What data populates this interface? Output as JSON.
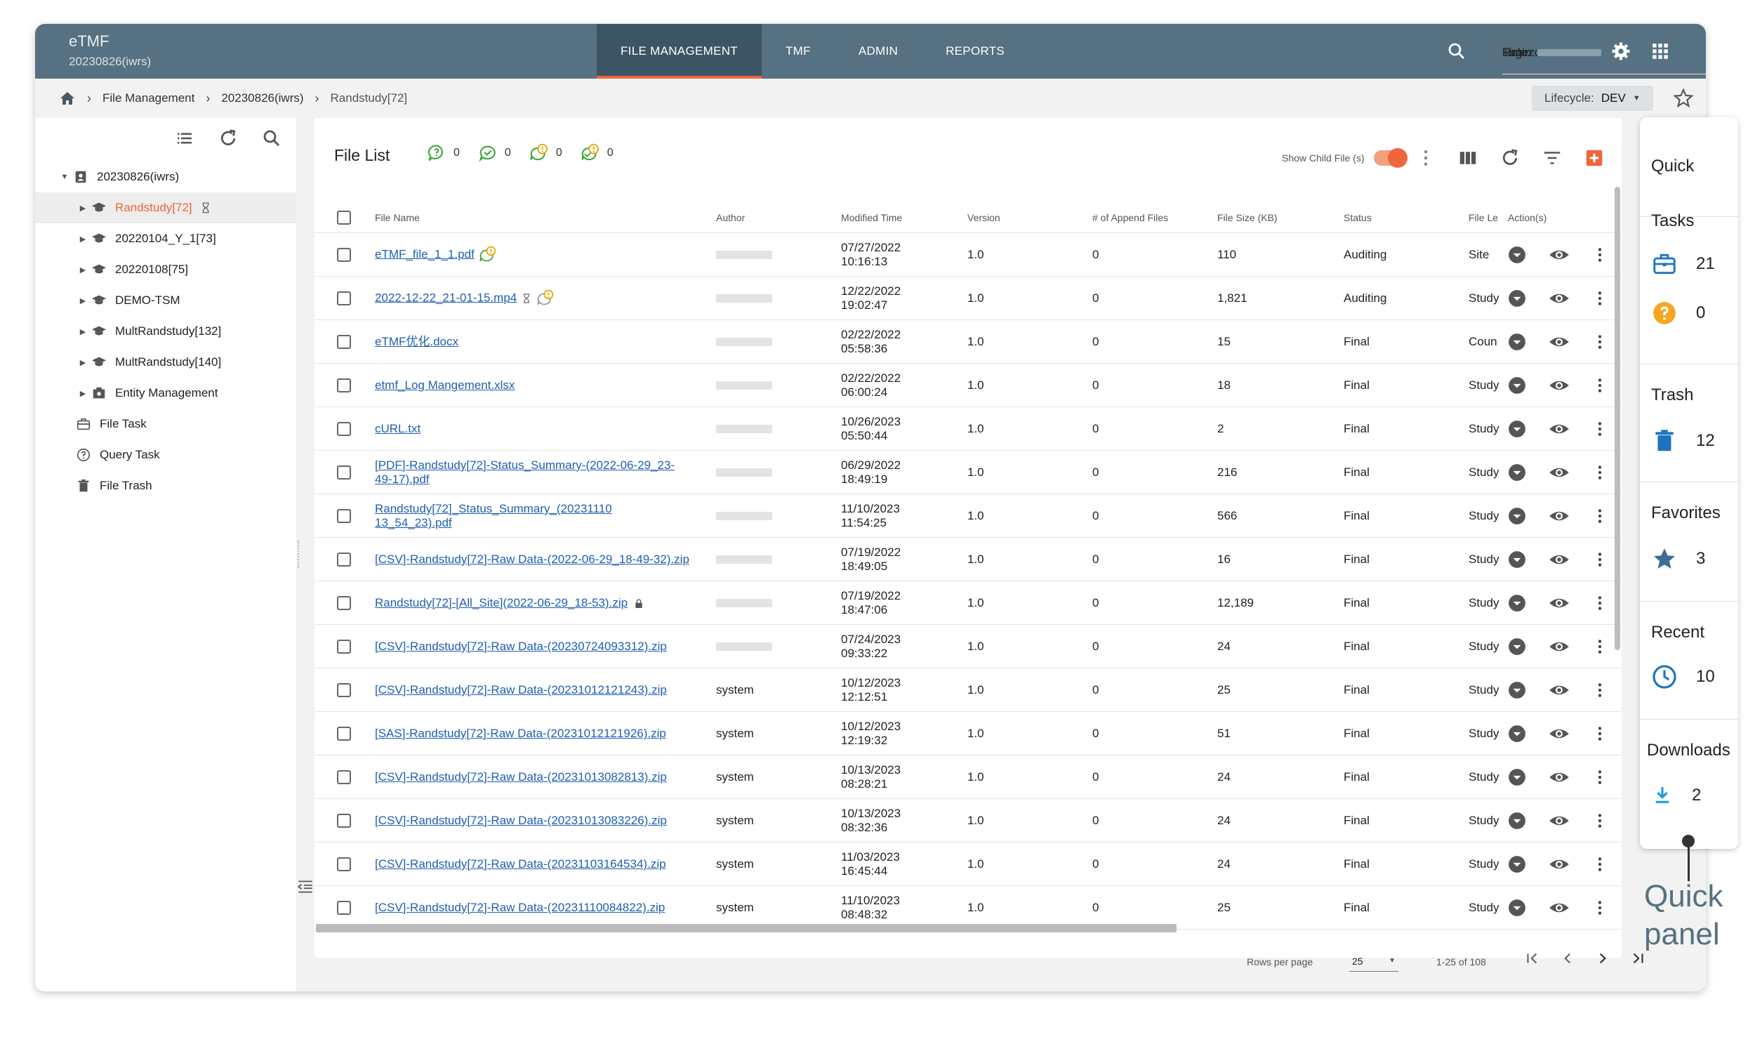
{
  "app": {
    "title": "eTMF",
    "subtitle": "20230826(iwrs)"
  },
  "nav": {
    "items": [
      {
        "label": "FILE MANAGEMENT",
        "active": true
      },
      {
        "label": "TMF"
      },
      {
        "label": "ADMIN"
      },
      {
        "label": "REPORTS"
      }
    ]
  },
  "user": {
    "login_label": "Login:",
    "timezone_label": "Timezone:",
    "role_label": "Role:"
  },
  "breadcrumb": {
    "items": [
      "File Management",
      "20230826(iwrs)",
      "Randstudy[72]"
    ]
  },
  "lifecycle": {
    "label": "Lifecycle:",
    "value": "DEV"
  },
  "tree": {
    "root": "20230826(iwrs)",
    "studies": [
      "Randstudy[72]",
      "20220104_Y_1[73]",
      "20220108[75]",
      "DEMO-TSM",
      "MultRandstudy[132]",
      "MultRandstudy[140]",
      "Entity Management"
    ],
    "links": [
      "File Task",
      "Query Task",
      "File Trash"
    ]
  },
  "file_list": {
    "title": "File List",
    "counters": [
      "0",
      "0",
      "0",
      "0"
    ],
    "show_child_label": "Show Child File (s)",
    "columns": {
      "file_name": "File Name",
      "author": "Author",
      "modified": "Modified Time",
      "version": "Version",
      "append": "# of Append Files",
      "size": "File Size (KB)",
      "status": "Status",
      "level": "File Le",
      "actions": "Action(s)"
    },
    "rows": [
      {
        "name": "eTMF_file_1_1.pdf",
        "author": "",
        "date": "07/27/2022",
        "time": "10:16:13",
        "version": "1.0",
        "append": "0",
        "size": "110",
        "status": "Auditing",
        "level": "Site"
      },
      {
        "name": "2022-12-22_21-01-15.mp4",
        "author": "",
        "date": "12/22/2022",
        "time": "19:02:47",
        "version": "1.0",
        "append": "0",
        "size": "1,821",
        "status": "Auditing",
        "level": "Study"
      },
      {
        "name": "eTMF优化.docx",
        "author": "",
        "date": "02/22/2022",
        "time": "05:58:36",
        "version": "1.0",
        "append": "0",
        "size": "15",
        "status": "Final",
        "level": "Coun"
      },
      {
        "name": "etmf_Log Mangement.xlsx",
        "author": "",
        "date": "02/22/2022",
        "time": "06:00:24",
        "version": "1.0",
        "append": "0",
        "size": "18",
        "status": "Final",
        "level": "Study"
      },
      {
        "name": "cURL.txt",
        "author": "",
        "date": "10/26/2023",
        "time": "05:50:44",
        "version": "1.0",
        "append": "0",
        "size": "2",
        "status": "Final",
        "level": "Study"
      },
      {
        "name": "[PDF]-Randstudy[72]-Status_Summary-(2022-06-29_23-",
        "name2": "49-17).pdf",
        "author": "",
        "date": "06/29/2022",
        "time": "18:49:19",
        "version": "1.0",
        "append": "0",
        "size": "216",
        "status": "Final",
        "level": "Study"
      },
      {
        "name": "Randstudy[72]_Status_Summary_(20231110",
        "name2": "13_54_23).pdf",
        "author": "",
        "date": "11/10/2023",
        "time": "11:54:25",
        "version": "1.0",
        "append": "0",
        "size": "566",
        "status": "Final",
        "level": "Study"
      },
      {
        "name": "[CSV]-Randstudy[72]-Raw Data-(2022-06-29_18-49-32).zip",
        "author": "",
        "date": "07/19/2022",
        "time": "18:49:05",
        "version": "1.0",
        "append": "0",
        "size": "16",
        "status": "Final",
        "level": "Study"
      },
      {
        "name": "Randstudy[72]-[All_Site](2022-06-29_18-53).zip",
        "author": "",
        "date": "07/19/2022",
        "time": "18:47:06",
        "version": "1.0",
        "append": "0",
        "size": "12,189",
        "status": "Final",
        "level": "Study"
      },
      {
        "name": "[CSV]-Randstudy[72]-Raw Data-(20230724093312).zip",
        "author": "",
        "date": "07/24/2023",
        "time": "09:33:22",
        "version": "1.0",
        "append": "0",
        "size": "24",
        "status": "Final",
        "level": "Study"
      },
      {
        "name": "[CSV]-Randstudy[72]-Raw Data-(20231012121243).zip",
        "author": "system",
        "date": "10/12/2023",
        "time": "12:12:51",
        "version": "1.0",
        "append": "0",
        "size": "25",
        "status": "Final",
        "level": "Study"
      },
      {
        "name": "[SAS]-Randstudy[72]-Raw Data-(20231012121926).zip",
        "author": "system",
        "date": "10/12/2023",
        "time": "12:19:32",
        "version": "1.0",
        "append": "0",
        "size": "51",
        "status": "Final",
        "level": "Study"
      },
      {
        "name": "[CSV]-Randstudy[72]-Raw Data-(20231013082813).zip",
        "author": "system",
        "date": "10/13/2023",
        "time": "08:28:21",
        "version": "1.0",
        "append": "0",
        "size": "24",
        "status": "Final",
        "level": "Study"
      },
      {
        "name": "[CSV]-Randstudy[72]-Raw Data-(20231013083226).zip",
        "author": "system",
        "date": "10/13/2023",
        "time": "08:32:36",
        "version": "1.0",
        "append": "0",
        "size": "24",
        "status": "Final",
        "level": "Study"
      },
      {
        "name": "[CSV]-Randstudy[72]-Raw Data-(20231103164534).zip",
        "author": "system",
        "date": "11/03/2023",
        "time": "16:45:44",
        "version": "1.0",
        "append": "0",
        "size": "24",
        "status": "Final",
        "level": "Study"
      },
      {
        "name": "[CSV]-Randstudy[72]-Raw Data-(20231110084822).zip",
        "author": "system",
        "date": "11/10/2023",
        "time": "08:48:32",
        "version": "1.0",
        "append": "0",
        "size": "25",
        "status": "Final",
        "level": "Study"
      }
    ]
  },
  "pager": {
    "rows_per_page_label": "Rows per page",
    "rows_per_page": "25",
    "range": "1-25 of 108"
  },
  "quick_panel": {
    "title": "Quick",
    "tasks": {
      "title": "Tasks",
      "task_count": "21",
      "query_count": "0"
    },
    "trash": {
      "title": "Trash",
      "count": "12"
    },
    "favorites": {
      "title": "Favorites",
      "count": "3"
    },
    "recent": {
      "title": "Recent",
      "count": "10"
    },
    "downloads": {
      "title": "Downloads",
      "count": "2"
    },
    "annotation": "Quick panel"
  },
  "colors": {
    "topbar": "#567181",
    "accent": "#f0653a",
    "link": "#1f5fb3",
    "quick_icon": "#1e73c0",
    "warning": "#f5a623"
  }
}
